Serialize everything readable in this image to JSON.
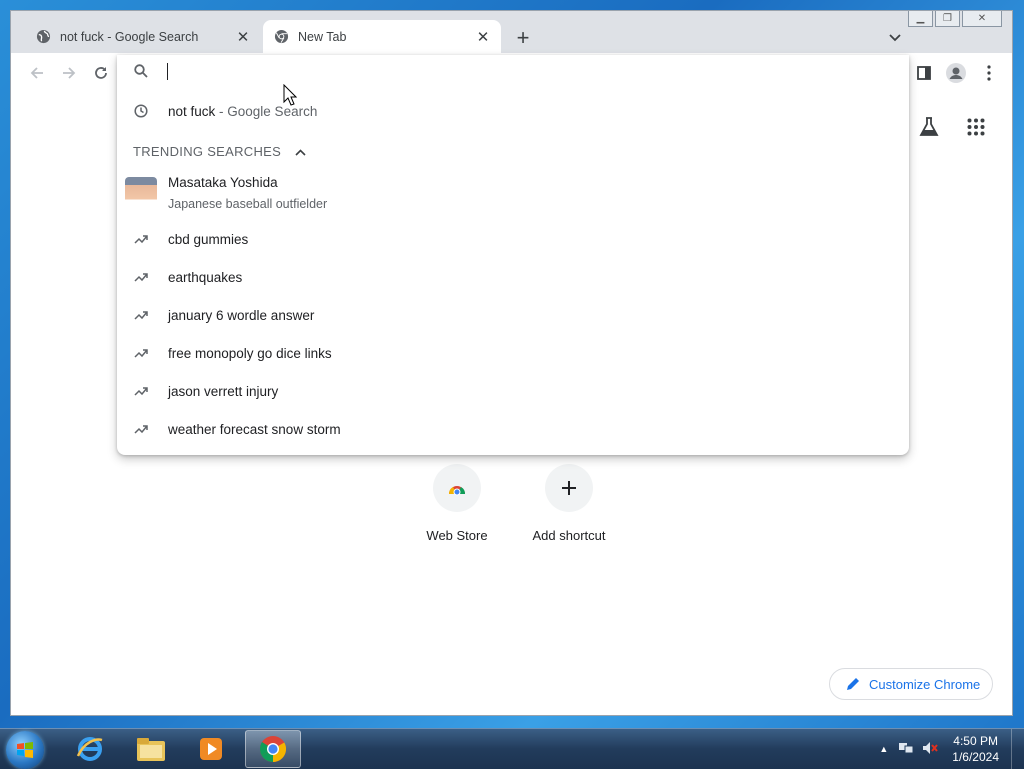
{
  "tabs": [
    {
      "title": "not fuck - Google Search",
      "active": false,
      "favicon": "globe-icon"
    },
    {
      "title": "New Tab",
      "active": true,
      "favicon": "chrome-icon"
    }
  ],
  "omnibox": {
    "history_item": {
      "query": "not fuck",
      "suffix": " - Google Search"
    },
    "trending_header": "TRENDING SEARCHES",
    "rich_suggestion": {
      "name": "Masataka Yoshida",
      "description": "Japanese baseball outfielder"
    },
    "trending": [
      "cbd gummies",
      "earthquakes",
      "january 6 wordle answer",
      "free monopoly go dice links",
      "jason verrett injury",
      "weather forecast snow storm"
    ]
  },
  "shortcuts": [
    {
      "label": "Web Store",
      "icon": "webstore-icon"
    },
    {
      "label": "Add shortcut",
      "icon": "plus-icon"
    }
  ],
  "customize_label": "Customize Chrome",
  "taskbar": {
    "apps": [
      "internet-explorer-icon",
      "file-explorer-icon",
      "media-player-icon",
      "chrome-icon"
    ],
    "time": "4:50 PM",
    "date": "1/6/2024"
  }
}
